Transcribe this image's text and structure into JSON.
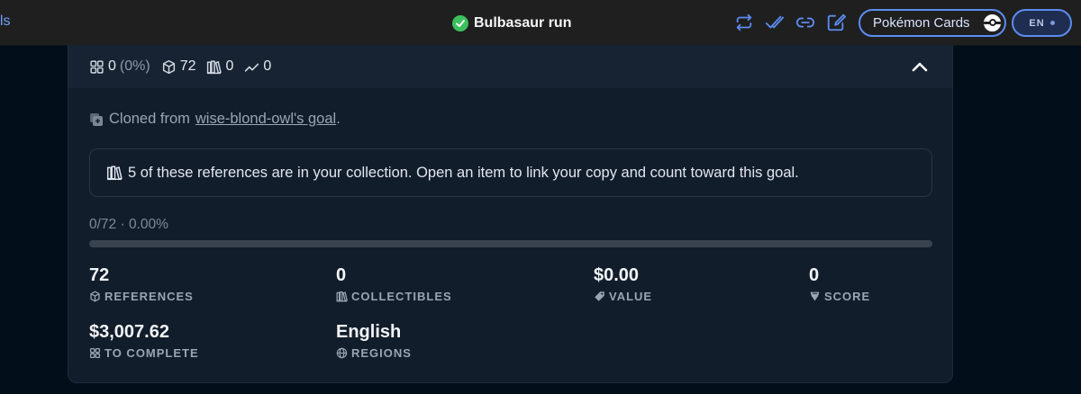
{
  "topbar": {
    "left_fragment": "ls",
    "title": "Bulbasaur run",
    "icons": [
      "repeat-icon",
      "double-check-icon",
      "link-icon",
      "edit-icon"
    ],
    "collection_pill": "Pokémon Cards",
    "language_pill": "EN"
  },
  "summary": {
    "owned": "0",
    "owned_pct": "(0%)",
    "references": "72",
    "collectibles": "0",
    "trend": "0"
  },
  "cloned": {
    "prefix": "Cloned from",
    "link": "wise-blond-owl's goal",
    "suffix": "."
  },
  "notice": "5 of these references are in your collection. Open an item to link your copy and count toward this goal.",
  "progress": {
    "text": "0/72 · 0.00%",
    "fraction": 0
  },
  "metrics": {
    "references": {
      "value": "72",
      "label": "REFERENCES"
    },
    "collectibles": {
      "value": "0",
      "label": "COLLECTIBLES"
    },
    "value": {
      "value": "$0.00",
      "label": "VALUE"
    },
    "score": {
      "value": "0",
      "label": "SCORE"
    },
    "to_complete": {
      "value": "$3,007.62",
      "label": "TO COMPLETE"
    },
    "regions": {
      "value": "English",
      "label": "REGIONS"
    }
  },
  "colors": {
    "accent": "#5b8cf0",
    "success": "#3cbf5d",
    "card_bg": "#121d2c",
    "page_bg": "#030e1b"
  }
}
